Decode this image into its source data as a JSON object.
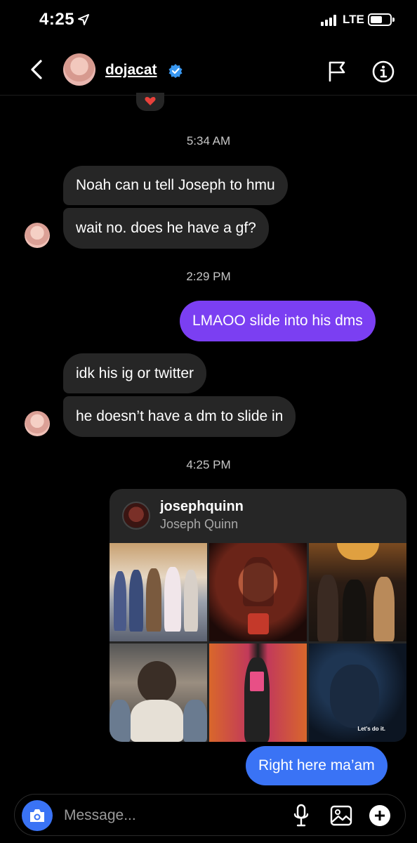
{
  "status_bar": {
    "time": "4:25",
    "network": "LTE"
  },
  "header": {
    "username": "dojacat"
  },
  "messages": [
    {
      "type": "timestamp",
      "text": "5:34 AM"
    },
    {
      "type": "received",
      "text": "Noah can u tell Joseph to hmu"
    },
    {
      "type": "received",
      "text": "wait no. does he have a gf?"
    },
    {
      "type": "timestamp",
      "text": "2:29 PM"
    },
    {
      "type": "sent",
      "text": "LMAOO slide into his dms"
    },
    {
      "type": "received",
      "text": "idk his ig or twitter"
    },
    {
      "type": "received",
      "text": "he doesn’t have a dm to slide in"
    },
    {
      "type": "timestamp",
      "text": "4:25 PM"
    },
    {
      "type": "sent",
      "text": "Right here ma’am"
    }
  ],
  "shared_profile": {
    "handle": "josephquinn",
    "name": "Joseph Quinn",
    "tile_caption": "Let's do it."
  },
  "composer": {
    "placeholder": "Message..."
  },
  "colors": {
    "sent_purple": "#7b3ff2",
    "sent_blue": "#3a73f5",
    "received_bubble": "#262626",
    "background": "#000000"
  },
  "icons": [
    "location-arrow-icon",
    "signal-icon",
    "battery-icon",
    "back-arrow-icon",
    "verified-badge-icon",
    "flag-icon",
    "info-icon",
    "heart-icon",
    "camera-icon",
    "microphone-icon",
    "gallery-icon",
    "plus-icon"
  ]
}
